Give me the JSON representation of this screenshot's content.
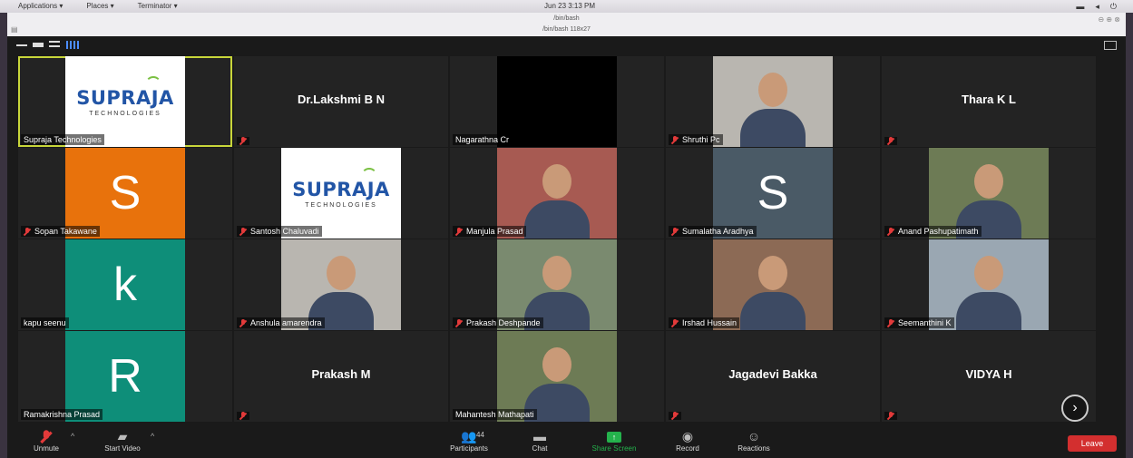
{
  "system_bar": {
    "menus": [
      "Applications ▾",
      "Places ▾",
      "Terminator ▾"
    ],
    "clock": "Jun 23  3:13 PM"
  },
  "window_title": {
    "line1": "/bin/bash",
    "line2": "/bin/bash 118x27"
  },
  "participants": [
    {
      "name": "Supraja Technologies",
      "tile_text": "",
      "type": "logo",
      "muted": false,
      "active": true
    },
    {
      "name": "Dr.Lakshmi B N",
      "tile_text": "Dr.Lakshmi B N",
      "type": "name",
      "muted": true,
      "active": false
    },
    {
      "name": "Nagarathna Cr",
      "tile_text": "",
      "type": "video-dark",
      "muted": false,
      "active": false
    },
    {
      "name": "Shruthi Pc",
      "tile_text": "",
      "type": "photo",
      "muted": true,
      "active": false
    },
    {
      "name": "Thara K L",
      "tile_text": "Thara K L",
      "type": "name",
      "muted": true,
      "active": false
    },
    {
      "name": "Sopan Takawane",
      "tile_text": "S",
      "type": "letter",
      "muted": true,
      "active": false
    },
    {
      "name": "Santosh Chaluvadi",
      "tile_text": "",
      "type": "logo",
      "muted": true,
      "active": false
    },
    {
      "name": "Manjula Prasad",
      "tile_text": "",
      "type": "photo",
      "muted": true,
      "active": false
    },
    {
      "name": "Sumalatha Aradhya",
      "tile_text": "S",
      "type": "letter",
      "muted": true,
      "active": false
    },
    {
      "name": "Anand Pashupatimath",
      "tile_text": "",
      "type": "photo",
      "muted": true,
      "active": false
    },
    {
      "name": "kapu seenu",
      "tile_text": "k",
      "type": "letter",
      "muted": false,
      "active": false
    },
    {
      "name": "Anshula amarendra",
      "tile_text": "",
      "type": "photo",
      "muted": true,
      "active": false
    },
    {
      "name": "Prakash Deshpande",
      "tile_text": "",
      "type": "photo",
      "muted": true,
      "active": false
    },
    {
      "name": "Irshad Hussain",
      "tile_text": "",
      "type": "photo",
      "muted": true,
      "active": false
    },
    {
      "name": "Seemanthini K",
      "tile_text": "",
      "type": "photo",
      "muted": true,
      "active": false
    },
    {
      "name": "Ramakrishna Prasad",
      "tile_text": "R",
      "type": "letter",
      "muted": false,
      "active": false
    },
    {
      "name": "Prakash M",
      "tile_text": "Prakash M",
      "type": "name",
      "muted": true,
      "active": false
    },
    {
      "name": "Mahantesh Mathapati",
      "tile_text": "",
      "type": "photo",
      "muted": false,
      "active": false
    },
    {
      "name": "Jagadevi Bakka",
      "tile_text": "Jagadevi Bakka",
      "type": "name",
      "muted": true,
      "active": false
    },
    {
      "name": "VIDYA H",
      "tile_text": "VIDYA H",
      "type": "name",
      "muted": true,
      "active": false
    }
  ],
  "logo": {
    "word": "SUPRAJA",
    "sub": "TECHNOLOGIES"
  },
  "toolbar": {
    "unmute": "Unmute",
    "start_video": "Start Video",
    "participants": "Participants",
    "participant_count": "44",
    "chat": "Chat",
    "share_screen": "Share Screen",
    "record": "Record",
    "reactions": "Reactions",
    "leave": "Leave"
  },
  "colors": {
    "orange": "#e8720c",
    "teal": "#0e8e79",
    "slate": "#4a5a66",
    "active_border": "#c8d63a",
    "leave": "#d32f2f",
    "share_green": "#24b24c"
  },
  "icons": {
    "next_page": "chevron-right-icon",
    "mic_muted": "mic-muted-icon"
  }
}
